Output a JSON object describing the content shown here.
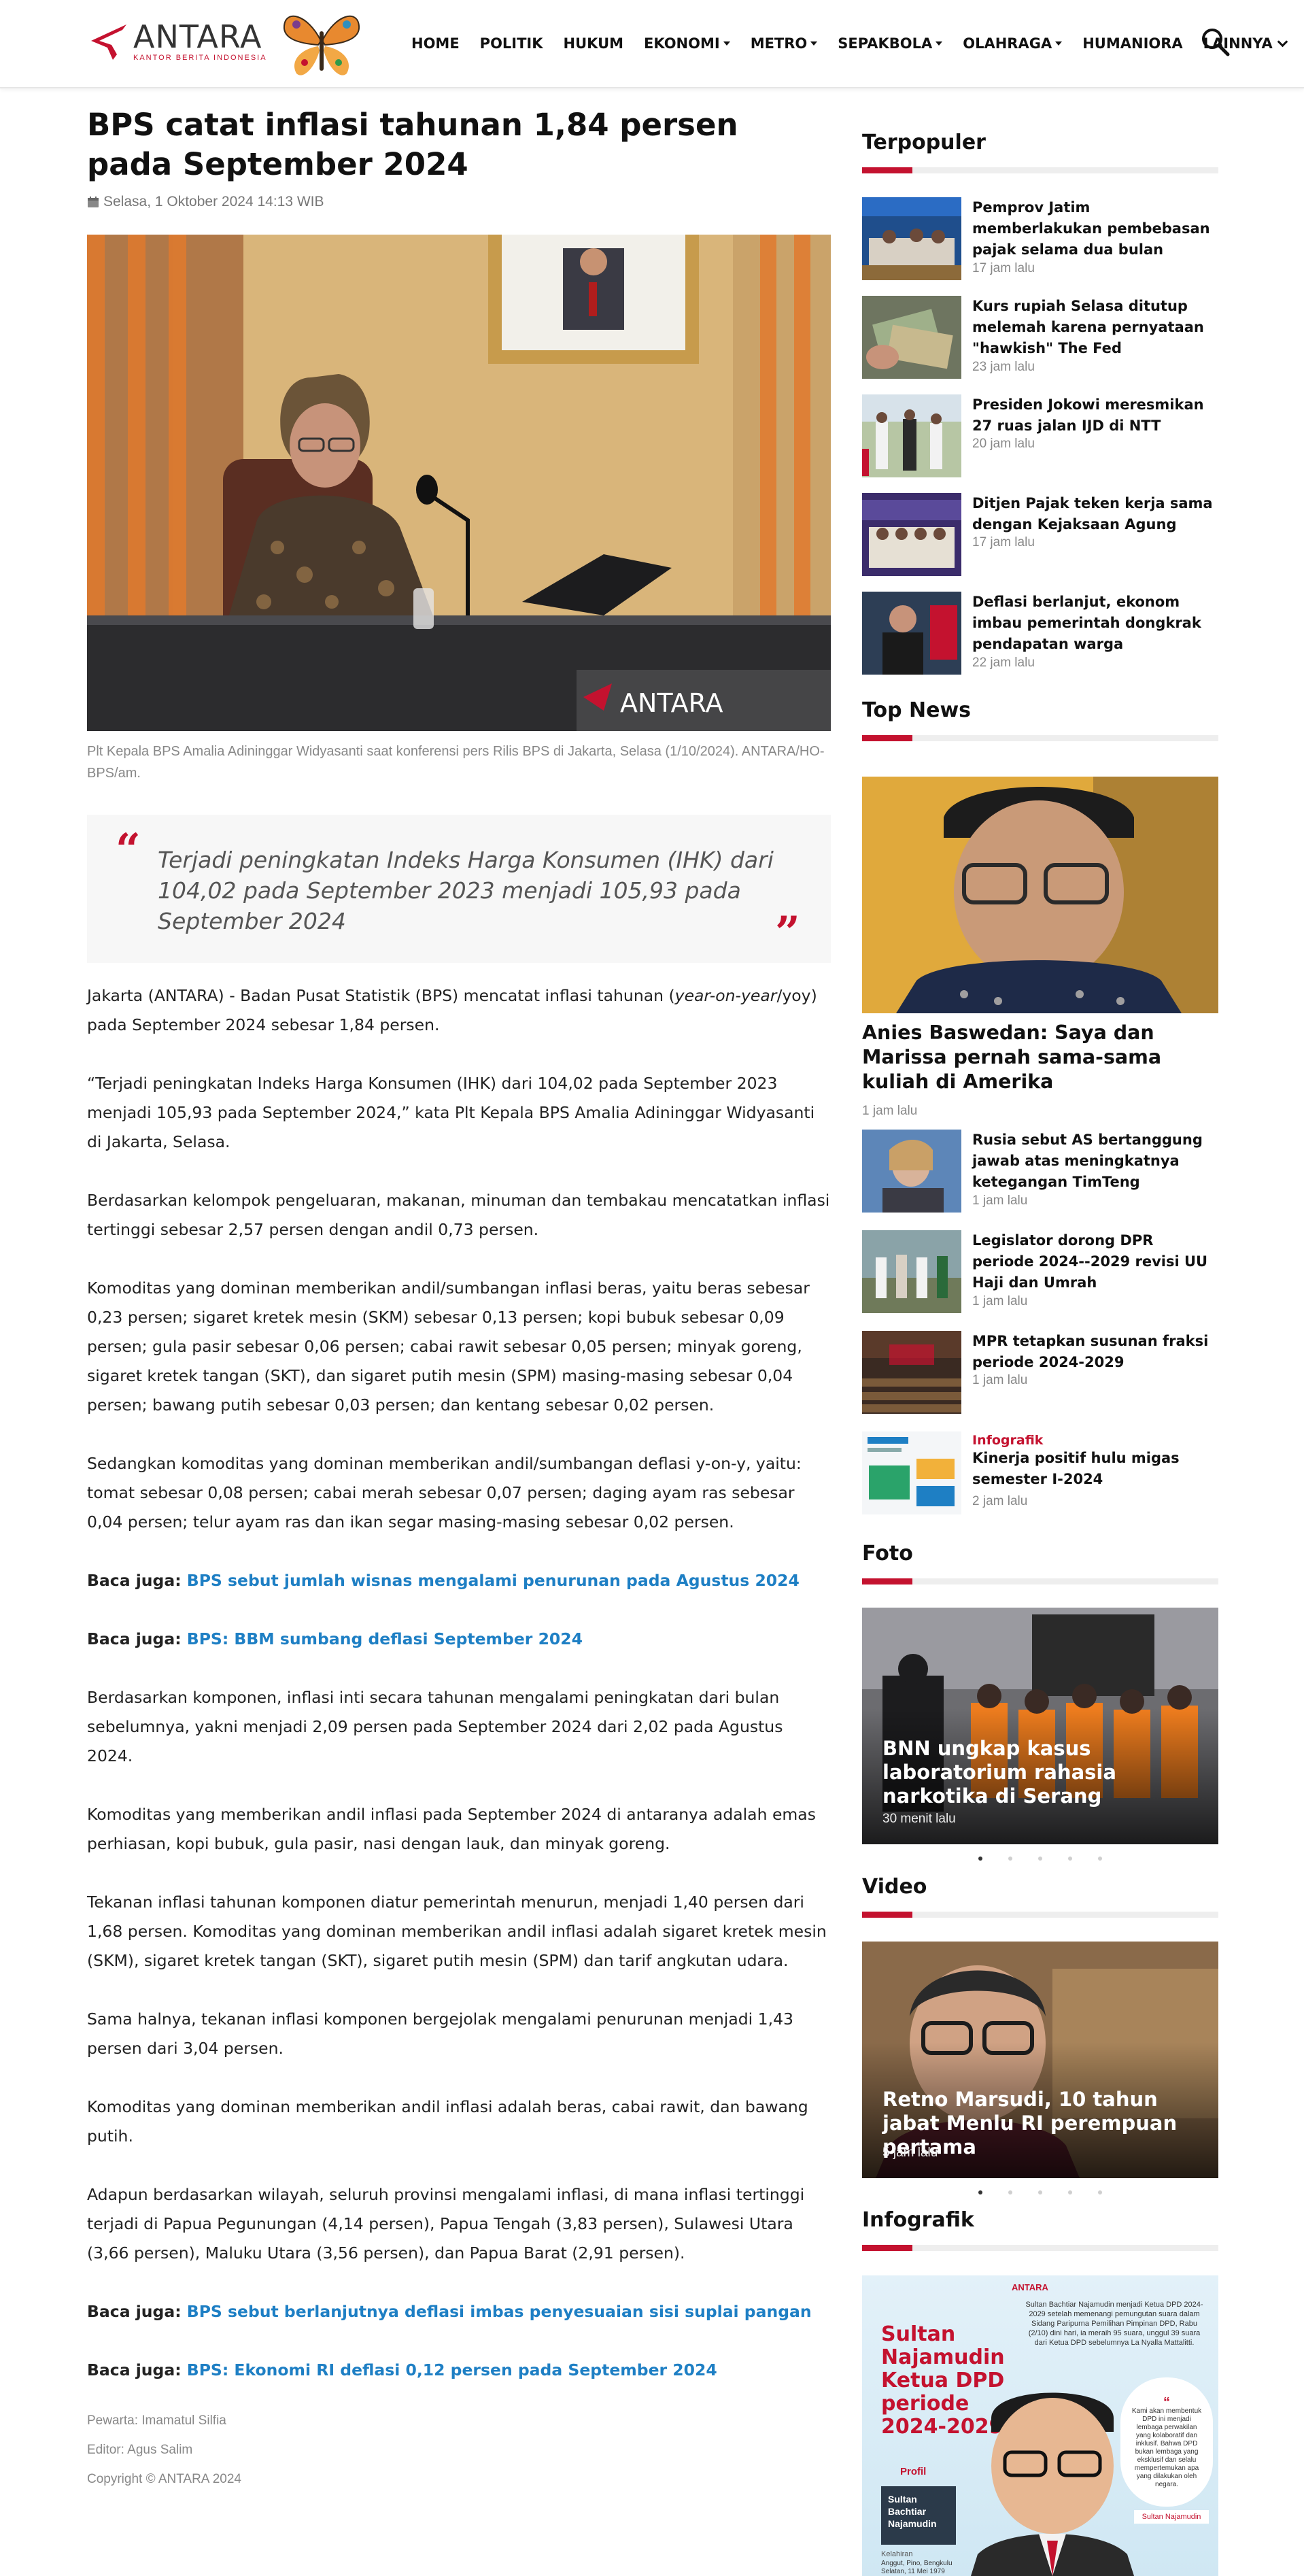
{
  "site": {
    "logo_text": "ANTARA",
    "logo_sub": "KANTOR BERITA INDONESIA"
  },
  "nav": {
    "items": [
      {
        "label": "HOME",
        "dropdown": false
      },
      {
        "label": "POLITIK",
        "dropdown": false
      },
      {
        "label": "HUKUM",
        "dropdown": false
      },
      {
        "label": "EKONOMI",
        "dropdown": true
      },
      {
        "label": "METRO",
        "dropdown": true
      },
      {
        "label": "SEPAKBOLA",
        "dropdown": true
      },
      {
        "label": "OLAHRAGA",
        "dropdown": true
      },
      {
        "label": "HUMANIORA",
        "dropdown": false
      },
      {
        "label": "LAINNYA",
        "dropdown": true
      }
    ],
    "search_icon": "search-icon"
  },
  "article": {
    "title": "BPS catat inflasi tahunan 1,84 persen pada September 2024",
    "date": "Selasa, 1 Oktober 2024 14:13 WIB",
    "photo_watermark": "ANTARA",
    "caption": "Plt Kepala BPS Amalia Adininggar Widyasanti saat konferensi pers Rilis BPS di Jakarta, Selasa (1/10/2024). ANTARA/HO-BPS/am.",
    "pullquote": "Terjadi peningkatan Indeks Harga Konsumen (IHK) dari 104,02 pada September 2023 menjadi 105,93 pada September 2024",
    "p1a": "Jakarta (ANTARA) - Badan Pusat Statistik (BPS) mencatat inflasi tahunan (",
    "p1b": "year-on-year",
    "p1c": "/yoy) pada September 2024 sebesar 1,84 persen.",
    "p2": "“Terjadi peningkatan Indeks Harga Konsumen (IHK) dari 104,02 pada September 2023 menjadi 105,93 pada September 2024,” kata Plt Kepala BPS Amalia Adininggar Widyasanti di Jakarta, Selasa.",
    "p3": "Berdasarkan kelompok pengeluaran, makanan, minuman dan tembakau mencatatkan inflasi tertinggi sebesar 2,57 persen dengan andil 0,73 persen.",
    "p4": "Komoditas yang dominan memberikan andil/sumbangan inflasi beras, yaitu beras sebesar 0,23 persen; sigaret kretek mesin (SKM) sebesar 0,13 persen; kopi bubuk sebesar 0,09 persen; gula pasir sebesar 0,06 persen; cabai rawit sebesar 0,05 persen; minyak goreng, sigaret kretek tangan (SKT), dan sigaret putih mesin (SPM) masing-masing sebesar 0,04 persen; bawang putih sebesar 0,03 persen; dan kentang sebesar 0,02 persen.",
    "p5": "Sedangkan komoditas yang dominan memberikan andil/sumbangan deflasi y-on-y, yaitu: tomat sebesar 0,08 persen; cabai merah sebesar 0,07 persen; daging ayam ras sebesar 0,04 persen; telur ayam ras dan ikan segar masing-masing sebesar 0,02 persen.",
    "baca_label": "Baca juga:",
    "baca1": "BPS sebut jumlah wisnas mengalami penurunan pada Agustus 2024",
    "baca2": "BPS: BBM sumbang deflasi September 2024",
    "p6": "Berdasarkan komponen, inflasi inti secara tahunan mengalami peningkatan dari bulan sebelumnya, yakni menjadi 2,09 persen pada September 2024 dari 2,02 pada Agustus 2024.",
    "p7": "Komoditas yang memberikan andil inflasi pada September 2024 di antaranya adalah emas perhiasan, kopi bubuk, gula pasir, nasi dengan lauk, dan minyak goreng.",
    "p8": "Tekanan inflasi tahunan komponen diatur pemerintah menurun, menjadi 1,40 persen dari 1,68 persen. Komoditas yang dominan memberikan andil inflasi adalah sigaret kretek mesin (SKM), sigaret kretek tangan (SKT), sigaret putih mesin (SPM) dan tarif angkutan udara.",
    "p9": "Sama halnya, tekanan inflasi komponen bergejolak mengalami penurunan menjadi 1,43 persen dari 3,04 persen.",
    "p10": "Komoditas yang dominan memberikan andil inflasi adalah beras, cabai rawit, dan bawang putih.",
    "p11": "Adapun berdasarkan wilayah, seluruh provinsi mengalami inflasi, di mana inflasi tertinggi terjadi di Papua Pegunungan (4,14 persen), Papua Tengah (3,83 persen), Sulawesi Utara (3,66 persen), Maluku Utara (3,56 persen), dan Papua Barat (2,91 persen).",
    "baca3": "BPS sebut berlanjutnya deflasi imbas penyesuaian sisi suplai pangan",
    "baca4": "BPS: Ekonomi RI deflasi 0,12 persen pada September 2024",
    "pewarta": "Pewarta: Imamatul Silfia",
    "editor": "Editor: Agus Salim",
    "copyright": "Copyright © ANTARA 2024"
  },
  "sidebar": {
    "terpopuler_title": "Terpopuler",
    "terpopuler": [
      {
        "title": "Pemprov Jatim memberlakukan pembebasan pajak selama dua bulan",
        "time": "17 jam lalu"
      },
      {
        "title": "Kurs rupiah Selasa ditutup melemah karena pernyataan \"hawkish\" The Fed",
        "time": "23 jam lalu"
      },
      {
        "title": "Presiden Jokowi meresmikan 27 ruas jalan IJD di NTT",
        "time": "20 jam lalu"
      },
      {
        "title": "Ditjen Pajak teken kerja sama dengan Kejaksaan Agung",
        "time": "17 jam lalu"
      },
      {
        "title": "Deflasi berlanjut, ekonom imbau pemerintah dongkrak pendapatan warga",
        "time": "22 jam lalu"
      }
    ],
    "topnews_title": "Top News",
    "topnews_hero": {
      "title": "Anies Baswedan: Saya dan Marissa pernah sama-sama kuliah di Amerika",
      "time": "1 jam lalu"
    },
    "topnews": [
      {
        "label": "",
        "title": "Rusia sebut AS bertanggung jawab atas meningkatnya ketegangan TimTeng",
        "time": "1 jam lalu"
      },
      {
        "label": "",
        "title": "Legislator dorong DPR periode 2024--2029 revisi UU Haji dan Umrah",
        "time": "1 jam lalu"
      },
      {
        "label": "",
        "title": "MPR tetapkan susunan fraksi periode 2024-2029",
        "time": "1 jam lalu"
      },
      {
        "label": "Infografik",
        "title": "Kinerja positif hulu migas semester I-2024",
        "time": "2 jam lalu"
      }
    ],
    "foto_title": "Foto",
    "foto": {
      "title": "BNN ungkap kasus laboratorium rahasia narkotika di Serang",
      "time": "30 menit lalu"
    },
    "video_title": "Video",
    "video": {
      "title": "Retno Marsudi, 10 tahun jabat Menlu RI perempuan pertama",
      "time": "5 jam lalu"
    },
    "infografik_title": "Infografik",
    "infografik": {
      "brand": "ANTARA",
      "headline": "Sultan Najamudin Ketua DPD periode 2024-2029",
      "desc": "Sultan Bachtiar Najamudin menjadi Ketua DPD 2024-2029 setelah memenangi pemungutan suara dalam Sidang Paripurna Pemilihan Pimpinan DPD, Rabu (2/10) dini hari, ia meraih 95 suara, unggul 39 suara dari Ketua DPD sebelumnya La Nyalla Mattalitti.",
      "profil_label": "Profil",
      "profil_name": "Sultan Bachtiar Najamudin",
      "kelahiran_label": "Kelahiran",
      "kelahiran": "Anggut, Pino, Bengkulu Selatan, 11 Mei 1979",
      "quote": "Kami akan membentuk DPD ini menjadi lembaga perwakilan yang kolaboratif dan inklusif. Bahwa DPD bukan lembaga yang eksklusif dan selalu mempertemukan apa yang dilakukan oleh negara.",
      "quote_name": "Sultan Najamudin"
    }
  },
  "colors": {
    "accent": "#c4122f",
    "link": "#1e7fc4"
  }
}
